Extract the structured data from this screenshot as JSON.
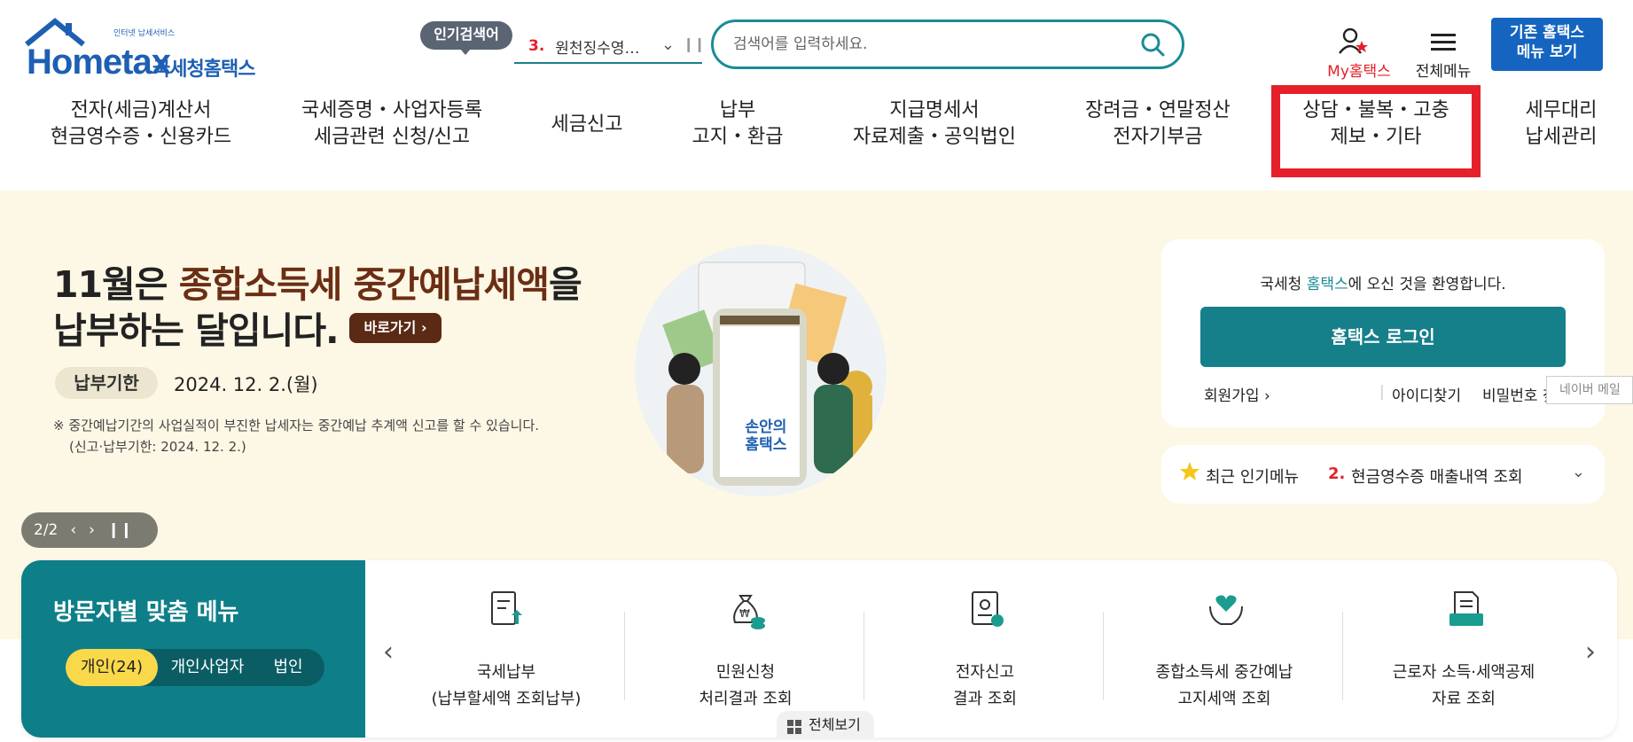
{
  "header": {
    "logo": {
      "brand": "Hometax",
      "small_text": "인터넷 납세서비스",
      "korean_name": "국세청홈택스"
    },
    "popular_search": {
      "badge": "인기검색어",
      "rank": "3.",
      "term": "원천징수영…"
    },
    "search": {
      "placeholder": "검색어를 입력하세요."
    },
    "my_hometax": "My홈택스",
    "all_menu": "전체메뉴",
    "old_hometax_button": [
      "기존 홈택스",
      "메뉴 보기"
    ]
  },
  "gnb": [
    {
      "line1": "전자(세금)계산서",
      "line2": "현금영수증・신용카드"
    },
    {
      "line1": "국세증명・사업자등록",
      "line2": "세금관련 신청/신고"
    },
    {
      "line1": "세금신고",
      "line2": ""
    },
    {
      "line1": "납부",
      "line2": "고지・환급"
    },
    {
      "line1": "지급명세서",
      "line2": "자료제출・공익법인"
    },
    {
      "line1": "장려금・연말정산",
      "line2": "전자기부금"
    },
    {
      "line1": "상담・불복・고충",
      "line2": "제보・기타"
    },
    {
      "line1": "세무대리",
      "line2": "납세관리"
    }
  ],
  "hero": {
    "title_prefix": "11월은 ",
    "title_highlight": "종합소득세 중간예납세액",
    "title_suffix": "을",
    "title_line2": "납부하는 달입니다.",
    "go_button": "바로가기",
    "due_label": "납부기한",
    "due_date": "2024. 12. 2.(월)",
    "note_line1": "※ 중간예납기간의 사업실적이 부진한 납세자는 중간예납 추계액 신고를 할 수 있습니다.",
    "note_line2": "(신고·납부기한: 2024. 12. 2.)",
    "image_caption": [
      "손안의",
      "홈택스"
    ],
    "pager": "2/2"
  },
  "login": {
    "welcome_prefix": "국세청 ",
    "welcome_highlight": "홈택스",
    "welcome_suffix": "에 오신 것을 환영합니다.",
    "button": "홈택스 로그인",
    "signup": "회원가입",
    "find_id": "아이디찾기",
    "find_pw": "비밀번호 찾"
  },
  "naver_tooltip": "네이버 메일",
  "recent_popular": {
    "label": "최근 인기메뉴",
    "rank": "2.",
    "item": "현금영수증 매출내역 조회"
  },
  "visitor_menu": {
    "title": "방문자별 맞춤 메뉴",
    "tabs": [
      "개인(24)",
      "개인사업자",
      "법인"
    ],
    "items": [
      {
        "line1": "국세납부",
        "line2": "(납부할세액 조회납부)",
        "icon": "tax-payment-icon"
      },
      {
        "line1": "민원신청",
        "line2": "처리결과 조회",
        "icon": "money-bag-icon"
      },
      {
        "line1": "전자신고",
        "line2": "결과 조회",
        "icon": "certificate-icon"
      },
      {
        "line1": "종합소득세 중간예납",
        "line2": "고지세액 조회",
        "icon": "heart-hands-icon"
      },
      {
        "line1": "근로자 소득·세액공제",
        "line2": "자료 조회",
        "icon": "document-tray-icon"
      }
    ],
    "view_all": "전체보기"
  },
  "colors": {
    "accent": "#1a8c96",
    "brand_blue": "#1565c0",
    "highlight_red": "#e5202a",
    "hero_bg": "#fdf8e5",
    "visitor_teal": "#0e7f88",
    "tab_yellow": "#f9d84a"
  }
}
